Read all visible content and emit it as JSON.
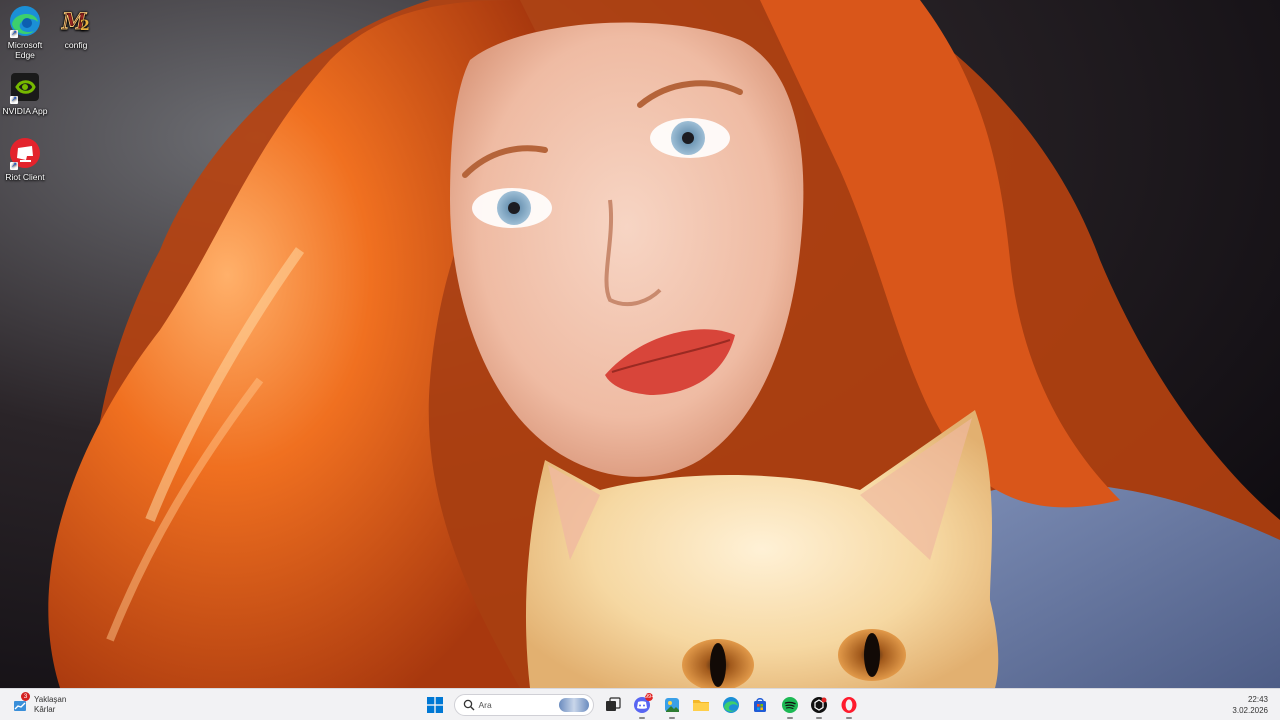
{
  "desktop": {
    "icons": [
      {
        "label": "Microsoft Edge"
      },
      {
        "label": "config"
      },
      {
        "label": "NVIDIA App"
      },
      {
        "label": "Riot Client"
      }
    ]
  },
  "taskbar": {
    "widget": {
      "badge": "3",
      "line1": "Yaklaşan",
      "line2": "Kârlar"
    },
    "search": {
      "placeholder": "Ara"
    },
    "apps": [
      {
        "name": "windows-start"
      },
      {
        "name": "task-view"
      },
      {
        "name": "discord",
        "notification": "99+"
      },
      {
        "name": "photos"
      },
      {
        "name": "file-explorer"
      },
      {
        "name": "edge"
      },
      {
        "name": "microsoft-store"
      },
      {
        "name": "spotify"
      },
      {
        "name": "chatgpt"
      },
      {
        "name": "opera"
      }
    ],
    "clock": {
      "time": "22:43",
      "date": "3.02.2026"
    }
  },
  "colors": {
    "taskbar_bg": "#f2f2f4",
    "accent": "#0067c0"
  }
}
